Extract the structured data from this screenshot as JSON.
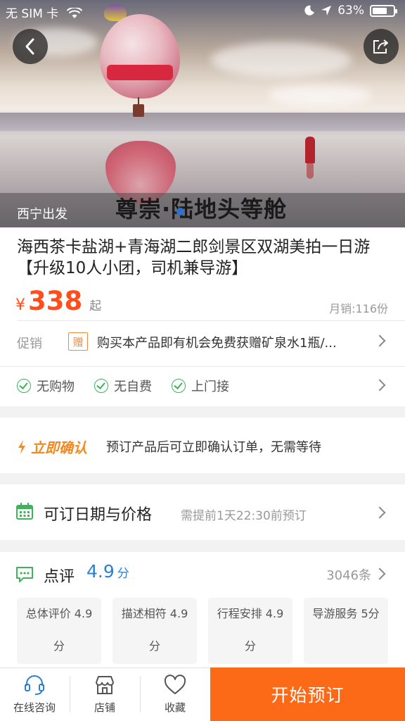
{
  "status_bar": {
    "carrier": "无 SIM 卡",
    "battery": "63%",
    "battery_level": 0.63
  },
  "hero": {
    "departure": "西宁出发",
    "tagline": "尊崇·陆地头等舱",
    "icons": [
      "back-icon",
      "share-icon"
    ]
  },
  "product": {
    "title": "海西茶卡盐湖+青海湖二郎剑景区双湖美拍一日游【升级10人小团，司机兼导游】",
    "currency": "¥",
    "price": "338",
    "price_suffix": "起",
    "monthly_sales": "月销:116份",
    "promo_label": "促销",
    "gift_badge": "赠",
    "promo_text": "购买本产品即有机会免费获赠矿泉水1瓶/..."
  },
  "features": [
    "无购物",
    "无自费",
    "上门接"
  ],
  "confirm": {
    "label": "立即确认",
    "text": "预订产品后可立即确认订单，无需等待"
  },
  "dates": {
    "title": "可订日期与价格",
    "note": "需提前1天22:30前预订"
  },
  "review": {
    "title": "点评",
    "score": "4.9",
    "score_unit": "分",
    "count": "3046条",
    "tiles": [
      {
        "line1": "总体评价 4.9",
        "line2": "分"
      },
      {
        "line1": "描述相符 4.9",
        "line2": "分"
      },
      {
        "line1": "行程安排 4.9",
        "line2": "分"
      },
      {
        "line1": "导游服务 5分",
        "line2": ""
      }
    ]
  },
  "bottom_bar": {
    "consult": "在线咨询",
    "store": "店铺",
    "favorite": "收藏",
    "book": "开始预订"
  },
  "colors": {
    "price": "#ff4d1c",
    "accent_orange": "#fc6a18",
    "confirm_orange": "#f5891f",
    "green": "#3fb25a",
    "blue": "#2d7fd3"
  }
}
